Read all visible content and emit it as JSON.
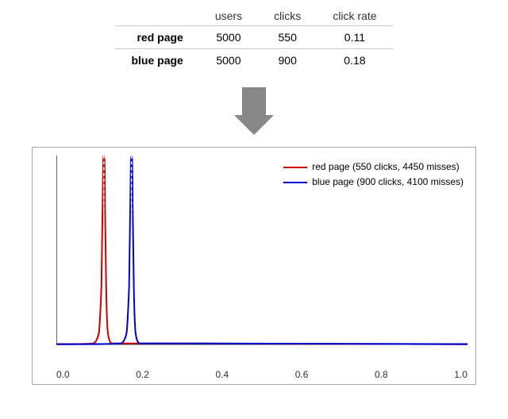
{
  "table": {
    "headers": [
      "",
      "users",
      "clicks",
      "click rate"
    ],
    "rows": [
      {
        "label": "red page",
        "users": "5000",
        "clicks": "550",
        "click_rate": "0.11"
      },
      {
        "label": "blue page",
        "users": "5000",
        "clicks": "900",
        "click_rate": "0.18"
      }
    ]
  },
  "chart": {
    "legend": [
      {
        "color": "#cc0000",
        "text": "red page (550 clicks, 4450 misses)"
      },
      {
        "color": "#0000cc",
        "text": "blue page (900 clicks, 4100 misses)"
      }
    ],
    "x_axis_labels": [
      "0.0",
      "0.2",
      "0.4",
      "0.6",
      "0.8",
      "1.0"
    ],
    "red_peak_x": 0.11,
    "blue_peak_x": 0.18
  },
  "arrow": "↓"
}
